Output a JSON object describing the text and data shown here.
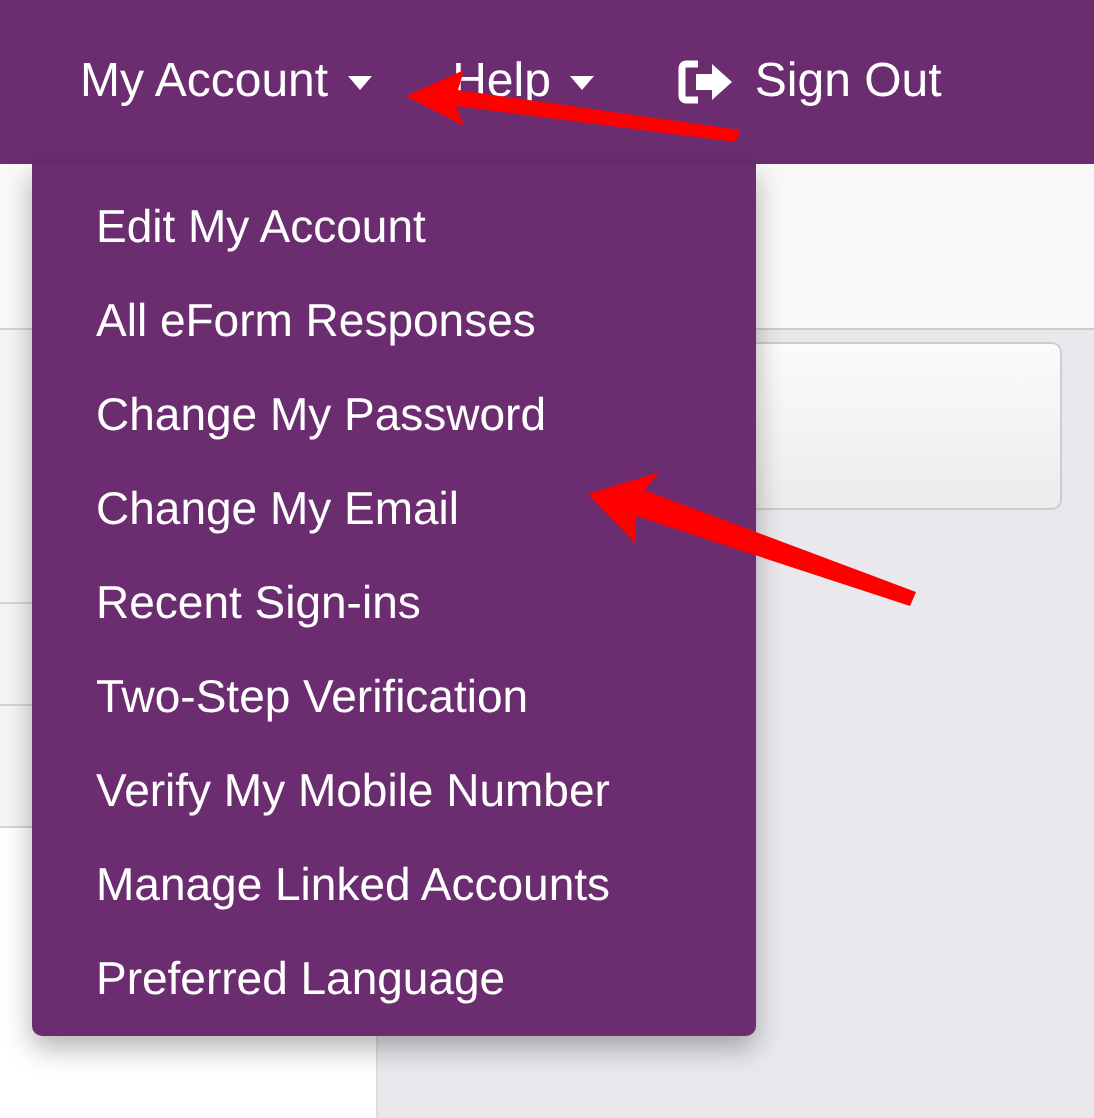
{
  "navbar": {
    "items": [
      {
        "kind": "dropdown",
        "label": "My Account",
        "expanded": true
      },
      {
        "kind": "dropdown",
        "label": "Help"
      },
      {
        "kind": "signout",
        "label": "Sign Out"
      }
    ]
  },
  "account_menu": {
    "items": [
      {
        "label": "Edit My Account"
      },
      {
        "label": "All eForm Responses"
      },
      {
        "label": "Change My Password"
      },
      {
        "label": "Change My Email"
      },
      {
        "label": "Recent Sign-ins"
      },
      {
        "label": "Two-Step Verification"
      },
      {
        "label": "Verify My Mobile Number"
      },
      {
        "label": "Manage Linked Accounts"
      },
      {
        "label": "Preferred Language"
      }
    ]
  }
}
